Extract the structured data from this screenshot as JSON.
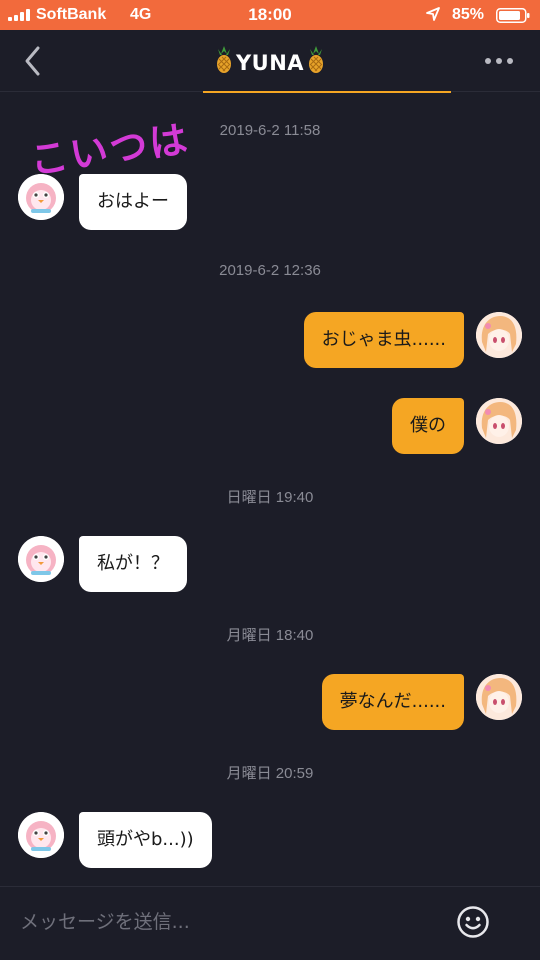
{
  "status_bar": {
    "carrier": "SoftBank",
    "network": "4G",
    "time": "18:00",
    "battery": "85%"
  },
  "header": {
    "title": "YUNA",
    "title_icon": "pineapple-icon",
    "back_icon": "chevron-left-icon",
    "more_icon": "more-dots-icon"
  },
  "annotation": "こいつは",
  "messages": [
    {
      "type": "timestamp",
      "text": "2019-6-2 11:58"
    },
    {
      "type": "message",
      "side": "in",
      "text": "おはよー"
    },
    {
      "type": "timestamp",
      "text": "2019-6-2 12:36"
    },
    {
      "type": "message",
      "side": "out",
      "text": "おじゃま虫......"
    },
    {
      "type": "message",
      "side": "out",
      "text": "僕の"
    },
    {
      "type": "timestamp",
      "text": "日曜日 19:40"
    },
    {
      "type": "message",
      "side": "in",
      "text": "私が！？"
    },
    {
      "type": "timestamp",
      "text": "月曜日 18:40"
    },
    {
      "type": "message",
      "side": "out",
      "text": "夢なんだ......"
    },
    {
      "type": "timestamp",
      "text": "月曜日 20:59"
    },
    {
      "type": "message",
      "side": "in",
      "text": "頭がやb...))"
    }
  ],
  "composer": {
    "placeholder": "メッセージを送信...",
    "emoji_icon": "smiley-icon"
  },
  "colors": {
    "status_bar": "#f26a3c",
    "background": "#1c1d28",
    "outgoing_bubble": "#f5a623",
    "incoming_bubble": "#ffffff",
    "annotation": "#d33ad6",
    "accent": "#f5a623"
  }
}
